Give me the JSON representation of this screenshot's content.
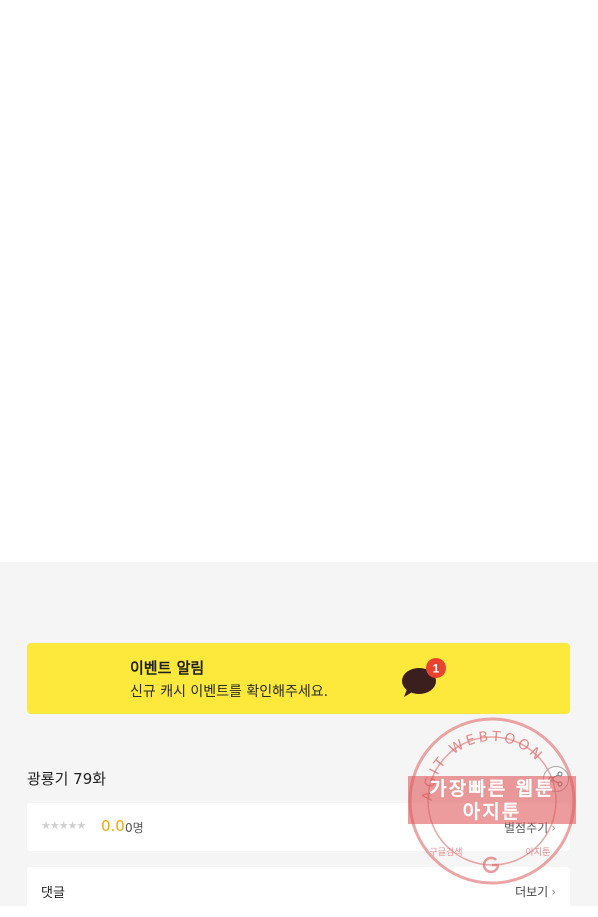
{
  "event_banner": {
    "title": "이벤트 알림",
    "description": "신규 캐시 이벤트를 확인해주세요.",
    "badge_count": "1",
    "icon": "chat-bubble-icon"
  },
  "episode": {
    "title": "광룡기 79화"
  },
  "rating": {
    "stars": "★★★★★",
    "score": "0.0",
    "count": "0명",
    "rate_label": "별점주기"
  },
  "comments": {
    "title": "댓글",
    "more_label": "더보기"
  },
  "watermark": {
    "ring_text": "AGIT WEBTOON",
    "line1": "가장빠른 웹툰",
    "line2": "아지툰",
    "lower_left": "구글검색",
    "lower_right": "아지툰"
  },
  "colors": {
    "banner_bg": "#fde93c",
    "badge": "#e8432e",
    "score": "#f5a700",
    "watermark": "#e05a5a"
  }
}
